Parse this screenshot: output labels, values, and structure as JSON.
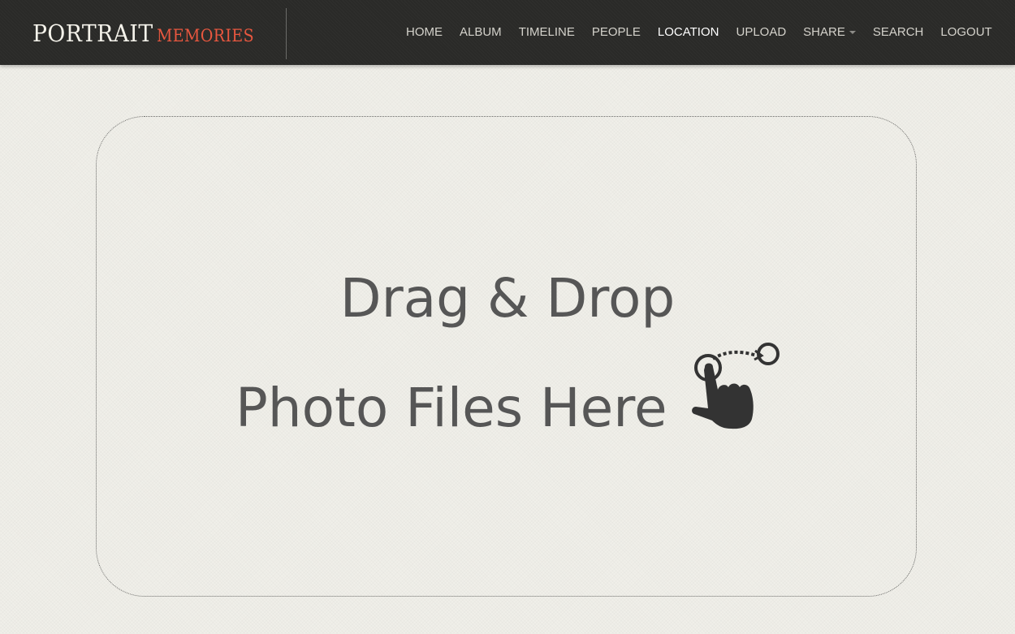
{
  "brand": {
    "main": "PORTRAIT",
    "accent": "MEMORIES"
  },
  "nav": {
    "items": [
      {
        "label": "HOME"
      },
      {
        "label": "ALBUM"
      },
      {
        "label": "TIMELINE"
      },
      {
        "label": "PEOPLE"
      },
      {
        "label": "LOCATION",
        "active": true
      },
      {
        "label": "UPLOAD"
      },
      {
        "label": "SHARE",
        "dropdown": true
      },
      {
        "label": "SEARCH"
      },
      {
        "label": "LOGOUT"
      }
    ]
  },
  "dropzone": {
    "line1": "Drag & Drop",
    "line2": "Photo Files Here",
    "icon": "drag-gesture-icon"
  },
  "colors": {
    "navbar": "#2a2a28",
    "brand_accent": "#e9573f",
    "background": "#f0efe9",
    "text": "#565656"
  }
}
